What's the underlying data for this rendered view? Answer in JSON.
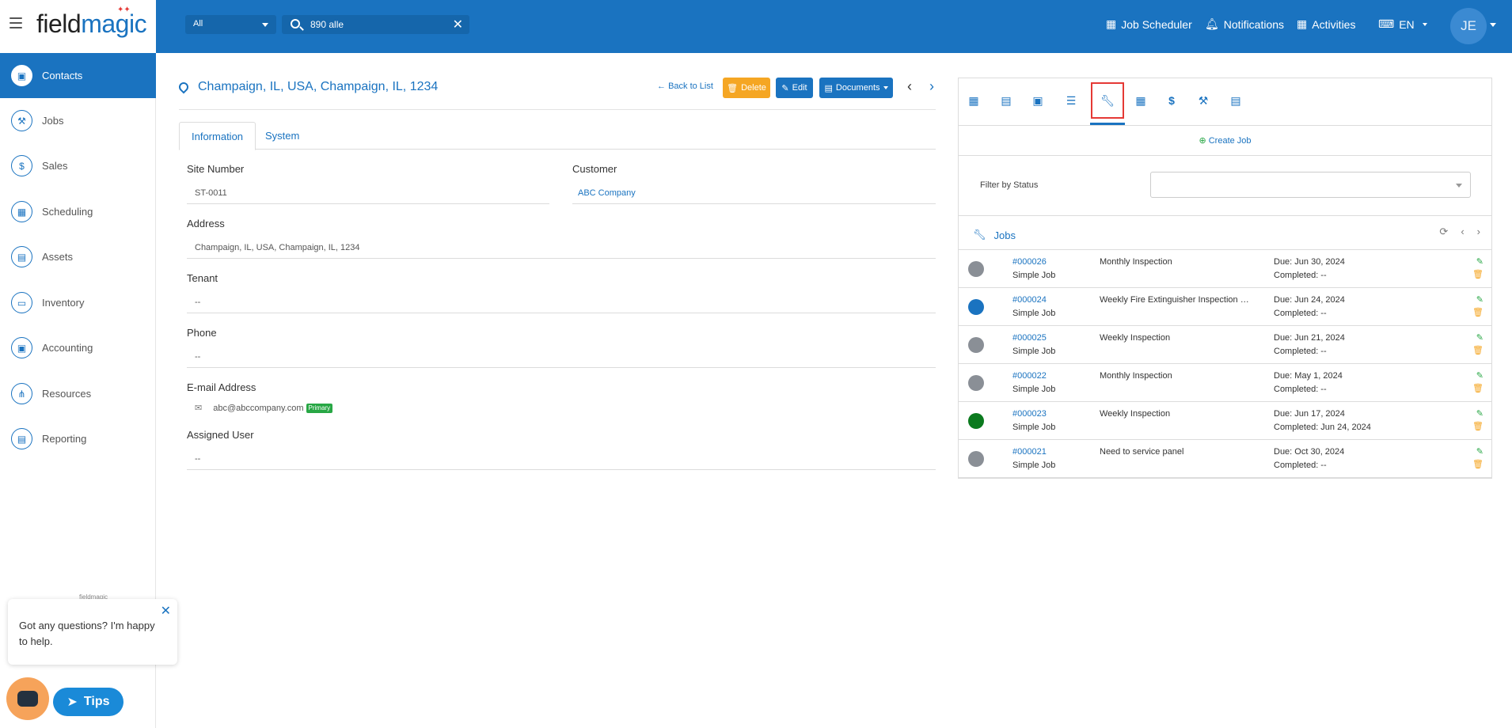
{
  "brand": {
    "logo_prefix": "field",
    "logo_suffix": "magic"
  },
  "topbar": {
    "scope": "All",
    "search_value": "890 alle",
    "nav": [
      {
        "label": "Job Scheduler",
        "icon": "calendar-icon"
      },
      {
        "label": "Notifications",
        "icon": "bell-icon"
      },
      {
        "label": "Activities",
        "icon": "calendar-icon"
      },
      {
        "label": "EN",
        "icon": "language-icon"
      }
    ],
    "avatar": "JE"
  },
  "sidebar": {
    "items": [
      {
        "label": "Contacts",
        "icon": "contacts-icon",
        "glyph": "▣",
        "active": true
      },
      {
        "label": "Jobs",
        "icon": "wrench-icon",
        "glyph": "🔧"
      },
      {
        "label": "Sales",
        "icon": "dollar-icon",
        "glyph": "$"
      },
      {
        "label": "Scheduling",
        "icon": "calendar-icon",
        "glyph": "▦"
      },
      {
        "label": "Assets",
        "icon": "briefcase-icon",
        "glyph": "▤"
      },
      {
        "label": "Inventory",
        "icon": "box-icon",
        "glyph": "▭"
      },
      {
        "label": "Accounting",
        "icon": "wallet-icon",
        "glyph": "▣"
      },
      {
        "label": "Resources",
        "icon": "network-icon",
        "glyph": "⋔"
      },
      {
        "label": "Reporting",
        "icon": "report-icon",
        "glyph": "▤"
      }
    ]
  },
  "chat": {
    "logo": "fieldmagic",
    "message": "Got any questions? I'm happy to help.",
    "tips_label": "Tips"
  },
  "record": {
    "title": "Champaign, IL, USA, Champaign, IL, 1234",
    "actions": {
      "back": "Back to List",
      "delete": "Delete",
      "edit": "Edit",
      "documents": "Documents"
    },
    "tabs": [
      "Information",
      "System"
    ],
    "fields": {
      "site_number_label": "Site Number",
      "site_number": "ST-0011",
      "customer_label": "Customer",
      "customer": "ABC Company",
      "address_label": "Address",
      "address": "Champaign, IL, USA, Champaign, IL, 1234",
      "tenant_label": "Tenant",
      "tenant": "--",
      "phone_label": "Phone",
      "phone": "--",
      "email_label": "E-mail Address",
      "email": "abc@abccompany.com",
      "email_badge": "Primary",
      "assigned_user_label": "Assigned User",
      "assigned_user": "--"
    }
  },
  "panel": {
    "icons": [
      "calendar-icon",
      "document-icon",
      "contact-card-icon",
      "list-icon",
      "wrench-icon",
      "calendar-alt-icon",
      "dollar-icon",
      "tools-icon",
      "invoice-icon"
    ],
    "active_icon": "wrench-icon",
    "create_job": "Create Job",
    "filter_label": "Filter by Status",
    "filter_value": "",
    "jobs_title": "Jobs",
    "jobs": [
      {
        "number": "#000026",
        "type": "Simple Job",
        "description": "Monthly Inspection",
        "due": "Due: Jun 30, 2024",
        "completed": "Completed: --",
        "status_color": "#8a8f96"
      },
      {
        "number": "#000024",
        "type": "Simple Job",
        "description": "Weekly Fire Extinguisher Inspection wit...",
        "due": "Due: Jun 24, 2024",
        "completed": "Completed: --",
        "status_color": "#1a73c0"
      },
      {
        "number": "#000025",
        "type": "Simple Job",
        "description": "Weekly Inspection",
        "due": "Due: Jun 21, 2024",
        "completed": "Completed: --",
        "status_color": "#8a8f96"
      },
      {
        "number": "#000022",
        "type": "Simple Job",
        "description": "Monthly Inspection",
        "due": "Due: May 1, 2024",
        "completed": "Completed: --",
        "status_color": "#8a8f96"
      },
      {
        "number": "#000023",
        "type": "Simple Job",
        "description": "Weekly Inspection",
        "due": "Due: Jun 17, 2024",
        "completed": "Completed: Jun 24, 2024",
        "status_color": "#0b7a1e"
      },
      {
        "number": "#000021",
        "type": "Simple Job",
        "description": "Need to service panel",
        "due": "Due: Oct 30, 2024",
        "completed": "Completed: --",
        "status_color": "#8a8f96"
      }
    ]
  }
}
